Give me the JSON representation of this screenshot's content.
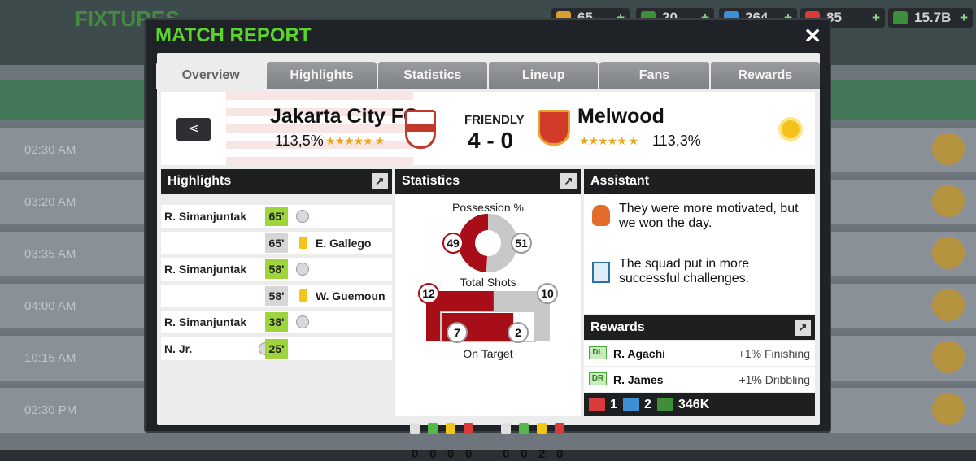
{
  "background": {
    "title": "FIXTURES",
    "times": [
      "02:30 AM",
      "03:20 AM",
      "03:35 AM",
      "04:00 AM",
      "10:15 AM",
      "02:30 PM"
    ],
    "resources": [
      {
        "value": "65",
        "color": "#d6a12b"
      },
      {
        "value": "20",
        "color": "#3f8f3a"
      },
      {
        "value": "264",
        "color": "#3d8fd6"
      },
      {
        "value": "85",
        "color": "#d93a3a"
      },
      {
        "value": "15.7B",
        "color": "#3f8f3a"
      }
    ],
    "plus": "+"
  },
  "dialog": {
    "title": "MATCH REPORT",
    "close": "✕"
  },
  "tabs": [
    "Overview",
    "Highlights",
    "Statistics",
    "Lineup",
    "Fans",
    "Rewards"
  ],
  "match": {
    "home": {
      "name": "Jakarta City FC",
      "rating": "113,5%"
    },
    "away": {
      "name": "Melwood",
      "rating": "113,3%"
    },
    "type": "FRIENDLY",
    "score": "4 - 0"
  },
  "sections": {
    "highlights": "Highlights",
    "statistics": "Statistics",
    "assistant": "Assistant",
    "rewards": "Rewards"
  },
  "highlights": [
    {
      "side": "home",
      "player": "R. Simanjuntak",
      "minute": "65'",
      "event": "goal"
    },
    {
      "side": "away",
      "player": "E. Gallego",
      "minute": "65'",
      "event": "yellow"
    },
    {
      "side": "home",
      "player": "R. Simanjuntak",
      "minute": "58'",
      "event": "goal"
    },
    {
      "side": "away",
      "player": "W. Guemoun",
      "minute": "58'",
      "event": "yellow"
    },
    {
      "side": "home",
      "player": "R. Simanjuntak",
      "minute": "38'",
      "event": "goal"
    },
    {
      "side": "home",
      "player": "N. Jr.",
      "minute": "25'",
      "event": "goal"
    }
  ],
  "statistics": {
    "possession_label": "Possession %",
    "possession": {
      "home": "49",
      "away": "51"
    },
    "shots_label": "Total Shots",
    "shots": {
      "home": "12",
      "away": "10"
    },
    "on_target_label": "On Target",
    "on_target": {
      "home": "7",
      "away": "2"
    },
    "cards_home": [
      "0",
      "0",
      "0",
      "0"
    ],
    "cards_away": [
      "0",
      "0",
      "2",
      "0"
    ]
  },
  "assistant": [
    "They were more motivated, but we won the day.",
    "The squad put in more successful challenges."
  ],
  "rewards": {
    "rows": [
      {
        "pos": "DL",
        "player": "R. Agachi",
        "reward": "+1% Finishing"
      },
      {
        "pos": "DR",
        "player": "R. James",
        "reward": "+1% Dribbling"
      }
    ],
    "medkit": "1",
    "energy": "2",
    "cash": "346K"
  },
  "colors": {
    "home": "#a80e17",
    "away": "#c8c8c8",
    "accent": "#5cd42f"
  }
}
